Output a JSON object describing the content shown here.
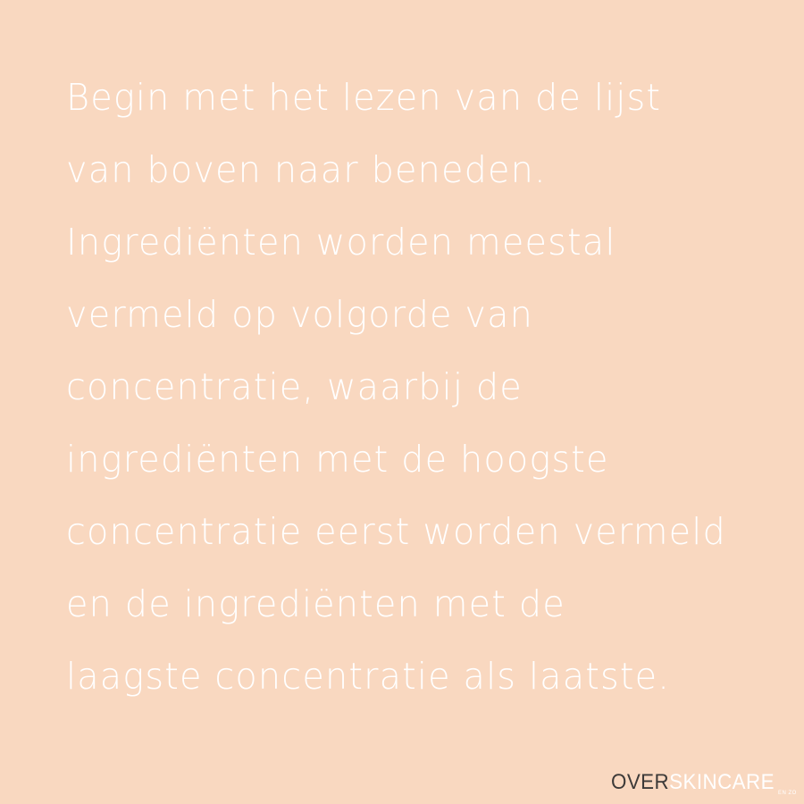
{
  "colors": {
    "background": "#f9d8c0",
    "body_text": "#ffffff",
    "logo_dark": "#3d3a38",
    "logo_light": "#ffffff"
  },
  "body_lines": [
    "Begin met het lezen van de lijst",
    "van boven naar beneden.",
    "Ingrediënten worden meestal",
    "vermeld op volgorde van",
    "concentratie, waarbij de",
    "ingrediënten met de hoogste",
    "concentratie eerst worden vermeld",
    "en de ingrediënten met de",
    "laagste concentratie als laatste."
  ],
  "logo": {
    "part_dark": "OVER",
    "part_light": "SKINCARE",
    "suffix": "EN ZO"
  }
}
